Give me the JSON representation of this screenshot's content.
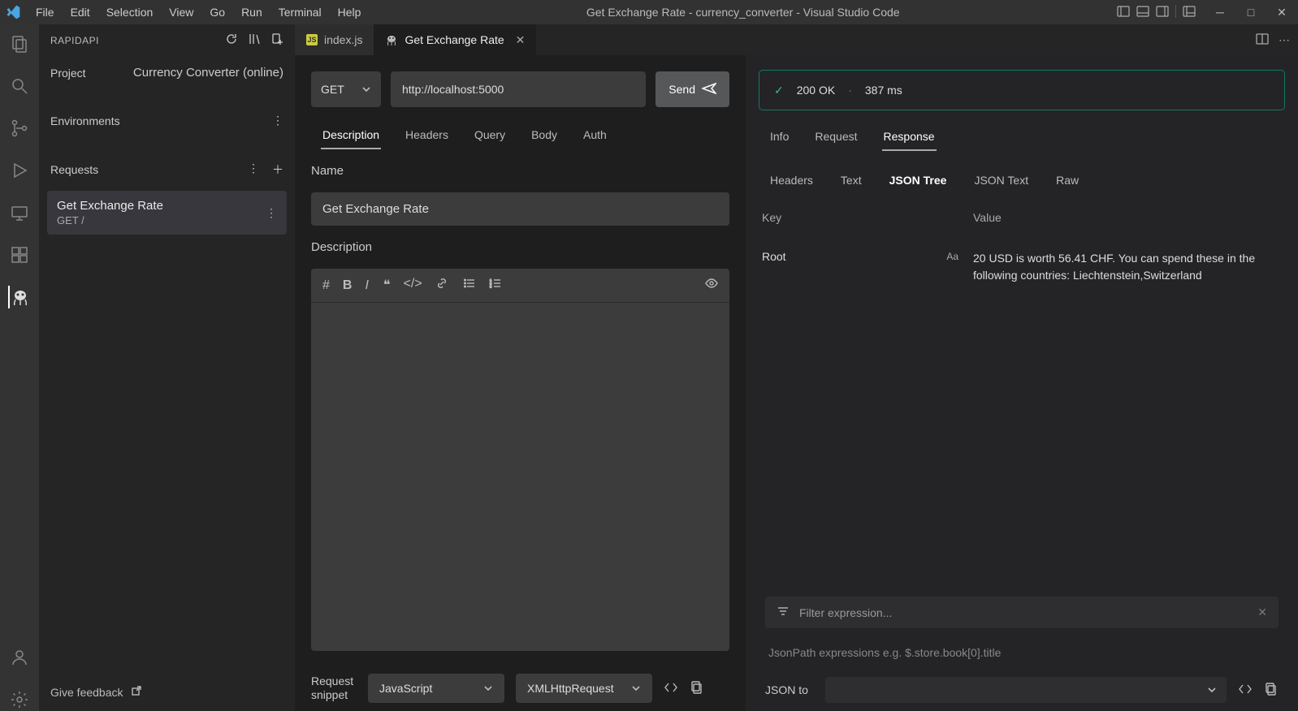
{
  "menubar": {
    "items": [
      "File",
      "Edit",
      "Selection",
      "View",
      "Go",
      "Run",
      "Terminal",
      "Help"
    ],
    "title": "Get Exchange Rate - currency_converter - Visual Studio Code"
  },
  "sidebar": {
    "header": "RAPIDAPI",
    "project_label": "Project",
    "project_name": "Currency Converter (online)",
    "environments_label": "Environments",
    "requests_label": "Requests",
    "request_item": {
      "name": "Get Exchange Rate",
      "sub": "GET /"
    },
    "feedback": "Give feedback"
  },
  "tabs": {
    "items": [
      {
        "label": "index.js",
        "kind": "js",
        "active": false
      },
      {
        "label": "Get Exchange Rate",
        "kind": "api",
        "active": true
      }
    ]
  },
  "request": {
    "method": "GET",
    "url": "http://localhost:5000",
    "send": "Send",
    "tabs": [
      "Description",
      "Headers",
      "Query",
      "Body",
      "Auth"
    ],
    "active_tab": "Description",
    "name_label": "Name",
    "name_value": "Get Exchange Rate",
    "description_label": "Description",
    "snippet_label": "Request snippet",
    "snippet_lang": "JavaScript",
    "snippet_lib": "XMLHttpRequest"
  },
  "response": {
    "status_code": "200 OK",
    "status_time": "387 ms",
    "tabs": [
      "Info",
      "Request",
      "Response"
    ],
    "active_tab": "Response",
    "subtabs": [
      "Headers",
      "Text",
      "JSON Tree",
      "JSON Text",
      "Raw"
    ],
    "active_subtab": "JSON Tree",
    "key_header": "Key",
    "value_header": "Value",
    "root_key": "Root",
    "root_type": "Aa",
    "root_value": "20 USD is worth 56.41 CHF. You can spend these in the following countries: Liechtenstein,Switzerland",
    "filter_placeholder": "Filter expression...",
    "filter_hint": "JsonPath expressions e.g. $.store.book[0].title",
    "json_to_label": "JSON to"
  }
}
